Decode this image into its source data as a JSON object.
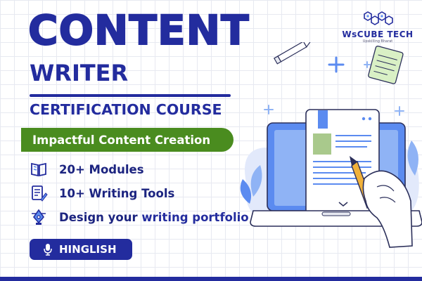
{
  "title": "CONTENT",
  "subtitle": "WRITER",
  "course": "CERTIFICATION COURSE",
  "banner": "Impactful Content Creation",
  "features": [
    {
      "icon": "book-icon",
      "text": "20+ Modules"
    },
    {
      "icon": "document-pen-icon",
      "text": "10+ Writing Tools"
    },
    {
      "icon": "pen-tool-icon",
      "text_prefix": "Design your ",
      "text_highlight": "writing portfolio"
    }
  ],
  "language": {
    "icon": "microphone-icon",
    "label": "HINGLISH"
  },
  "logo": {
    "name": "WsCUBE TECH",
    "tagline": "Upskilling Bharat"
  },
  "colors": {
    "primary": "#232c9e",
    "green": "#4a8c1f",
    "laptop": "#5b8bf0",
    "background": "#ffffff"
  }
}
